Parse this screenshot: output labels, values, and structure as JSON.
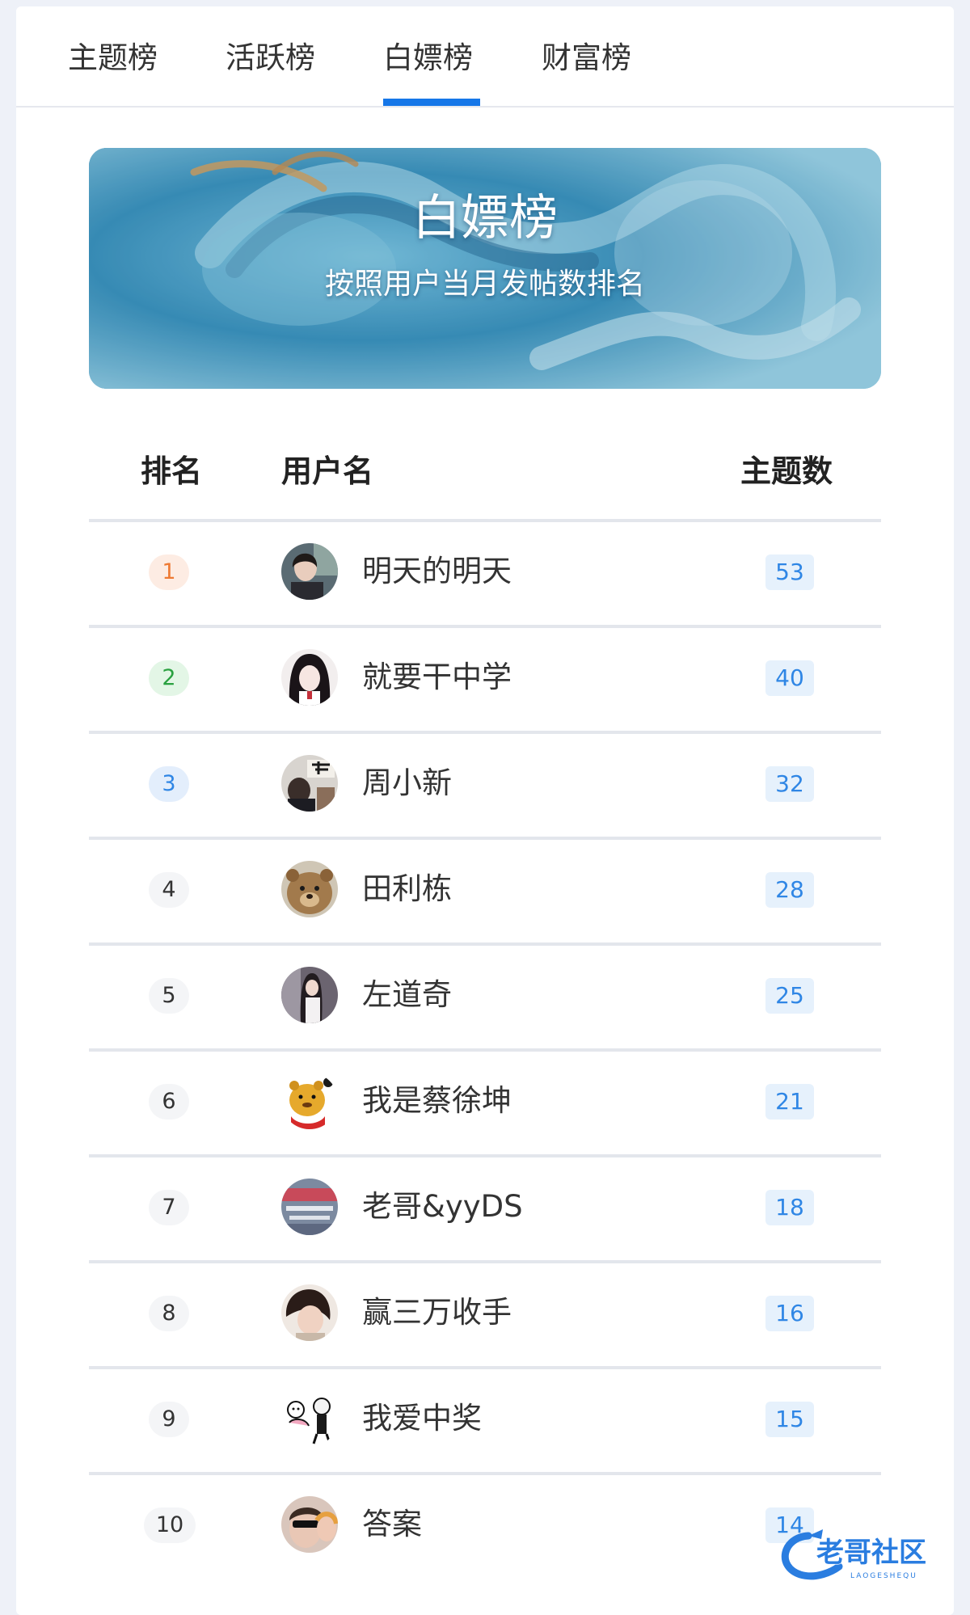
{
  "tabs": [
    {
      "label": "主题榜"
    },
    {
      "label": "活跃榜"
    },
    {
      "label": "白嫖榜"
    },
    {
      "label": "财富榜"
    }
  ],
  "active_tab": "白嫖榜",
  "banner": {
    "title": "白嫖榜",
    "subtitle": "按照用户当月发帖数排名"
  },
  "table": {
    "headers": {
      "rank": "排名",
      "user": "用户名",
      "count": "主题数"
    },
    "rows": [
      {
        "rank": "1",
        "name": "明天的明天",
        "count": "53"
      },
      {
        "rank": "2",
        "name": "就要干中学",
        "count": "40"
      },
      {
        "rank": "3",
        "name": "周小新",
        "count": "32"
      },
      {
        "rank": "4",
        "name": "田利栋",
        "count": "28"
      },
      {
        "rank": "5",
        "name": "左道奇",
        "count": "25"
      },
      {
        "rank": "6",
        "name": "我是蔡徐坤",
        "count": "21"
      },
      {
        "rank": "7",
        "name": "老哥&yyDS",
        "count": "18"
      },
      {
        "rank": "8",
        "name": "赢三万收手",
        "count": "16"
      },
      {
        "rank": "9",
        "name": "我爱中奖",
        "count": "15"
      },
      {
        "rank": "10",
        "name": "答案",
        "count": "14"
      }
    ]
  },
  "colors": {
    "accent": "#1677e8",
    "rank1": "#ee7a33",
    "rank2": "#2aa140",
    "rank3": "#2f86e5",
    "count": "#2f86e5"
  },
  "watermark": {
    "text": "老哥社区",
    "subtext": "LAOGESHEQU"
  }
}
